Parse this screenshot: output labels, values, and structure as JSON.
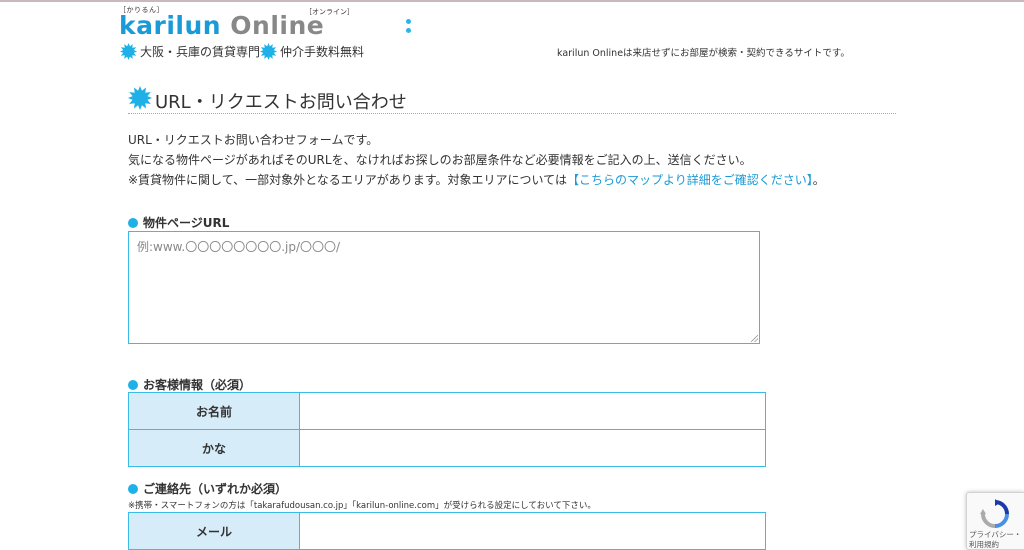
{
  "header": {
    "logo_ruby_left": "［かりるん］",
    "logo_word_1": "karilun",
    "logo_word_2": "Online",
    "logo_ruby_right": "［オンライン］",
    "tagline_1": "大阪・兵庫の賃貸専門",
    "tagline_2": "仲介手数料無料",
    "site_description": "karilun Onlineは来店せずにお部屋が検索・契約できるサイトです。"
  },
  "page": {
    "title": "URL・リクエストお問い合わせ",
    "intro_line_1": "URL・リクエストお問い合わせフォームです。",
    "intro_line_2": "気になる物件ページがあればそのURLを、なければお探しのお部屋条件など必要情報をご記入の上、送信ください。",
    "intro_line_3_before": "※賃貸物件に関して、一部対象外となるエリアがあります。対象エリアについては",
    "intro_line_3_link": "【こちらのマップより詳細をご確認ください】",
    "intro_line_3_after": "。"
  },
  "form": {
    "url_section": {
      "heading": "物件ページURL",
      "placeholder": "例:www.〇〇〇〇〇〇〇〇.jp/〇〇〇/",
      "value": ""
    },
    "customer_section": {
      "heading": "お客様情報（必須）",
      "rows": [
        {
          "label": "お名前",
          "value": ""
        },
        {
          "label": "かな",
          "value": ""
        }
      ]
    },
    "contact_section": {
      "heading": "ご連絡先（いずれか必須）",
      "note": "※携帯・スマートフォンの方は「takarafudousan.co.jp」「karilun-online.com」が受けられる設定にしておいて下さい。",
      "rows": [
        {
          "label": "メール",
          "value": ""
        }
      ]
    }
  },
  "recaptcha": {
    "line_1": "プライバシー・",
    "line_2": "利用規約"
  },
  "colors": {
    "accent": "#1eb0e6",
    "table_header_bg": "#d6ecf8",
    "border": "#3bbbe8",
    "link": "#1a9ad6"
  }
}
